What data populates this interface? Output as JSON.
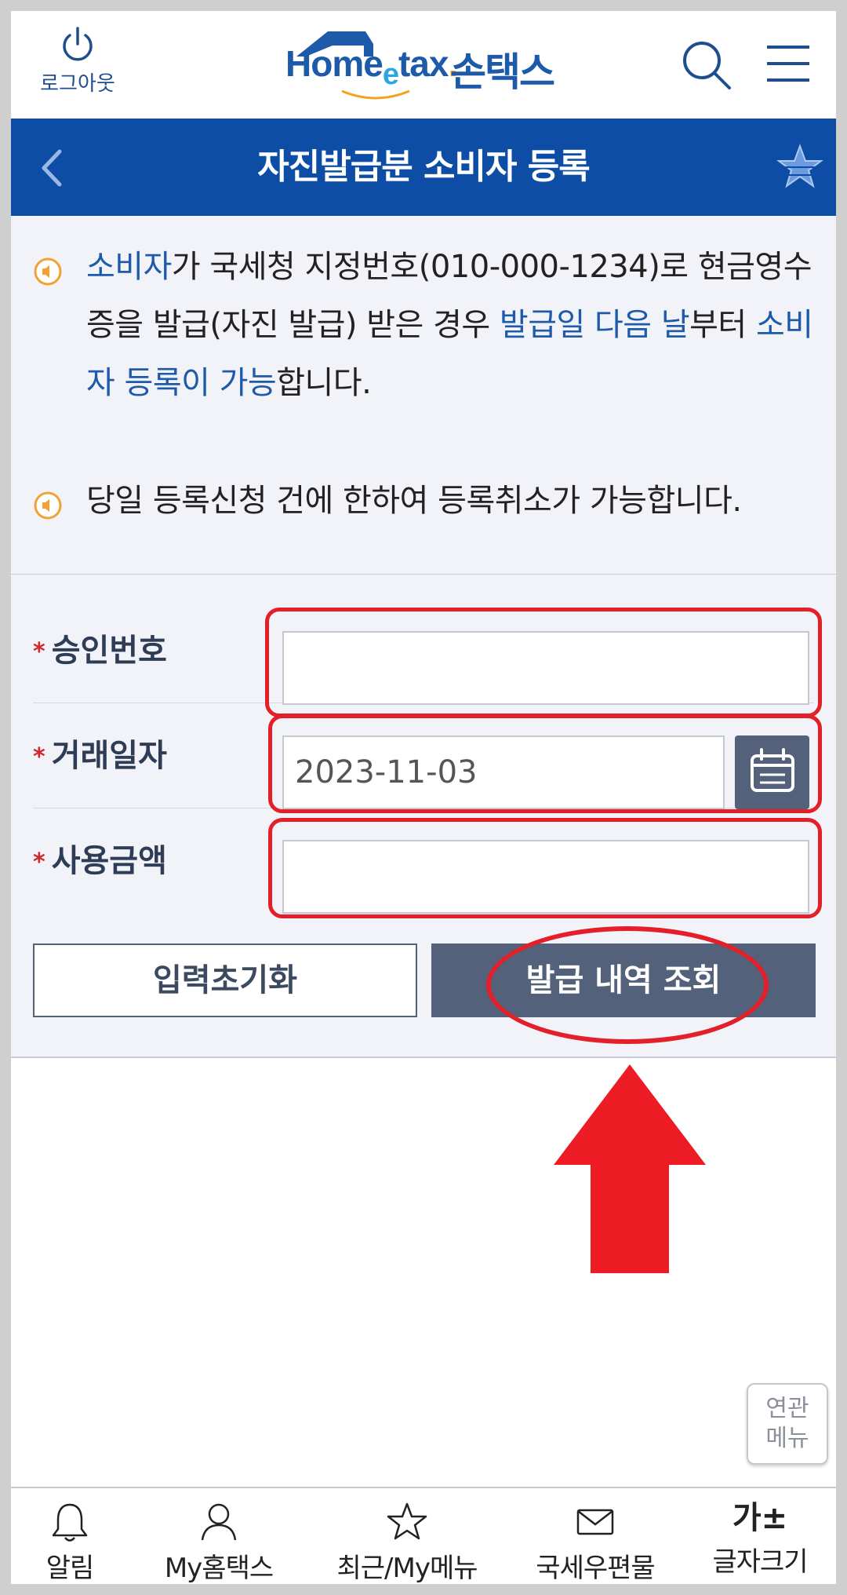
{
  "header": {
    "logout_label": "로그아웃",
    "logo_brand": "Home",
    "logo_e": "e",
    "logo_tax": "tax",
    "logo_dot": ".",
    "logo_kr": "손택스"
  },
  "titlebar": {
    "title": "자진발급분 소비자 등록"
  },
  "notices": [
    {
      "seg1": "소비자",
      "seg2": "가 국세청 지정번호(010-000-1234)로 현금영수증을 발급(자진 발급) 받은 경우 ",
      "seg3": "발급일 다음 날",
      "seg4": "부터 ",
      "seg5": "소비자 등록이 가능",
      "seg6": "합니다."
    },
    {
      "text": "당일 등록신청 건에 한하여 등록취소가 가능합니다."
    }
  ],
  "form": {
    "required_mark": "*",
    "approval_label": "승인번호",
    "approval_value": "",
    "date_label": "거래일자",
    "date_value": "2023-11-03",
    "amount_label": "사용금액",
    "amount_value": "",
    "reset_label": "입력초기화",
    "search_label": "발급 내역 조회"
  },
  "related_menu": {
    "line1": "연관",
    "line2": "메뉴"
  },
  "bottom_nav": [
    {
      "label": "알림",
      "icon": "bell-icon"
    },
    {
      "label": "My홈택스",
      "icon": "person-icon"
    },
    {
      "label": "최근/My메뉴",
      "icon": "star-icon"
    },
    {
      "label": "국세우편물",
      "icon": "mail-icon"
    },
    {
      "label": "글자크기",
      "icon": "font-size-icon",
      "glyph": "가±"
    }
  ],
  "colors": {
    "brand_blue": "#0e4da6",
    "button_slate": "#53627a",
    "annotation_red": "#e3202a",
    "notice_bg": "#f2f3f9"
  }
}
